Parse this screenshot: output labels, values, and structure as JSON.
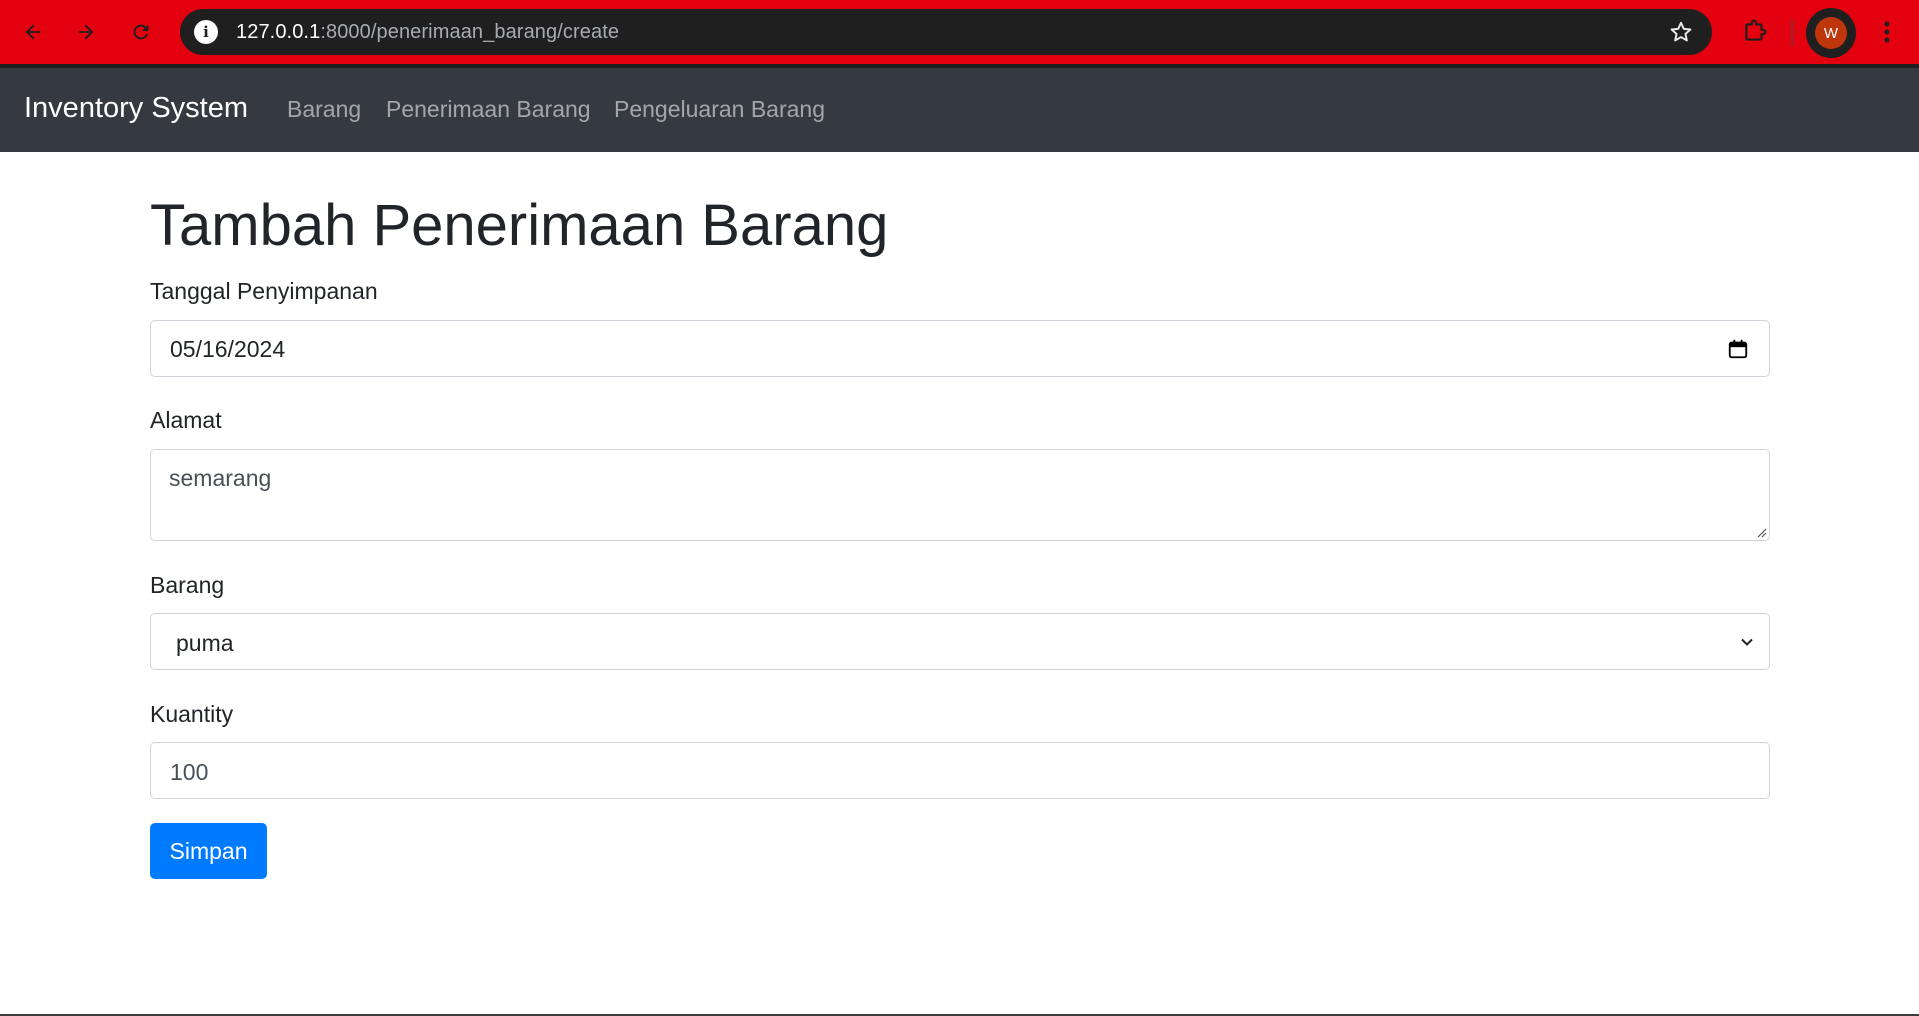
{
  "browser": {
    "url_host": "127.0.0.1",
    "url_rest": ":8000/penerimaan_barang/create",
    "profile_initial": "W",
    "accent_color": "#e3000f"
  },
  "navbar": {
    "brand": "Inventory System",
    "links": [
      {
        "label": "Barang"
      },
      {
        "label": "Penerimaan Barang"
      },
      {
        "label": "Pengeluaran Barang"
      }
    ]
  },
  "page": {
    "title": "Tambah Penerimaan Barang"
  },
  "form": {
    "tanggal_label": "Tanggal Penyimpanan",
    "tanggal_value": "05/16/2024",
    "alamat_label": "Alamat",
    "alamat_value": "semarang",
    "barang_label": "Barang",
    "barang_selected": "puma",
    "kuantity_label": "Kuantity",
    "kuantity_value": "100",
    "submit_label": "Simpan",
    "primary_color": "#007bff"
  }
}
